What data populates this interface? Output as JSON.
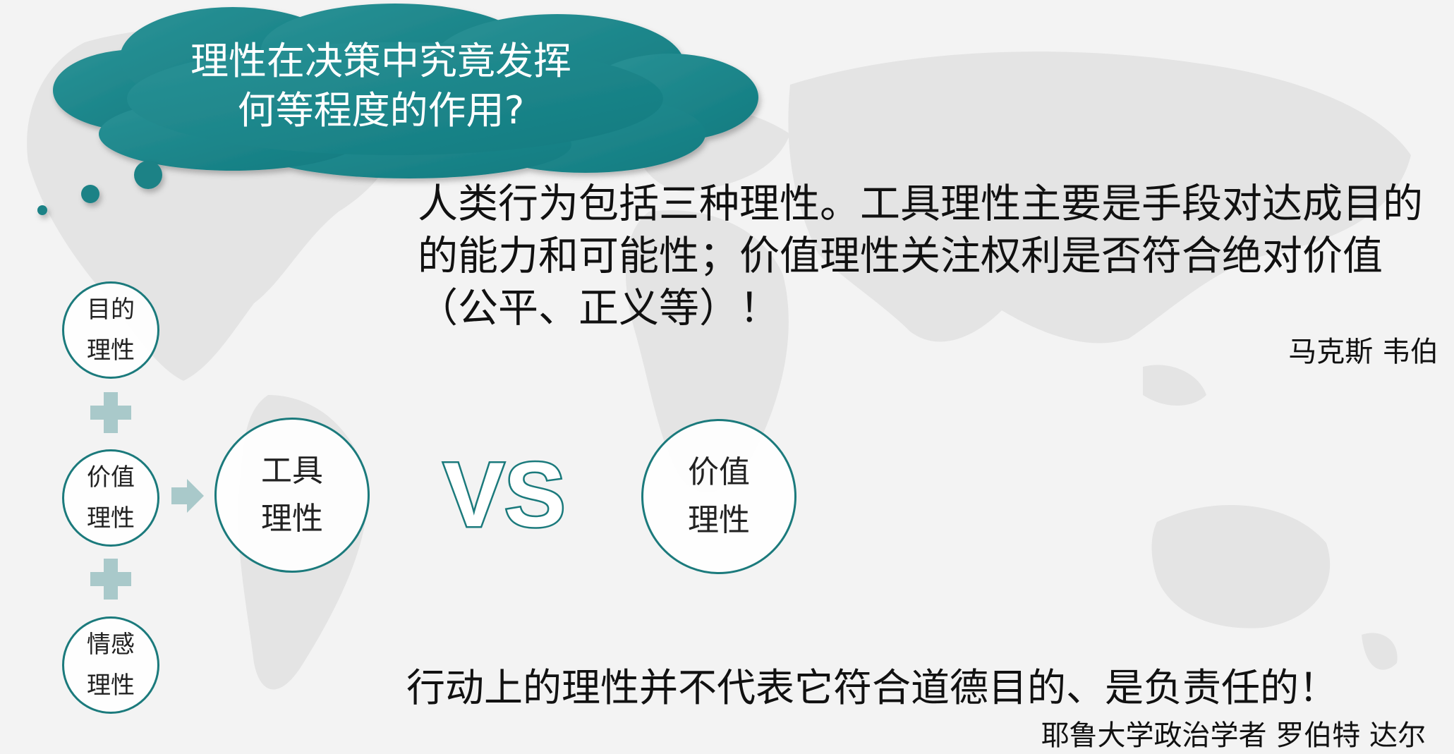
{
  "question": {
    "line1": "理性在决策中究竟发挥",
    "line2": "何等程度的作用?"
  },
  "weber_quote": {
    "text": "人类行为包括三种理性。工具理性主要是手段对达成目的的能力和可能性；价值理性关注权利是否符合绝对价值（公平、正义等）！",
    "author": "马克斯 韦伯"
  },
  "rationalities": [
    {
      "line1": "目的",
      "line2": "理性"
    },
    {
      "line1": "价值",
      "line2": "理性"
    },
    {
      "line1": "情感",
      "line2": "理性"
    }
  ],
  "instrumental": {
    "line1": "工具",
    "line2": "理性"
  },
  "versus": "VS",
  "value_rationality": {
    "line1": "价值",
    "line2": "理性"
  },
  "dahl_quote": {
    "text": "行动上的理性并不代表它符合道德目的、是负责任的！",
    "author": "耶鲁大学政治学者  罗伯特 达尔"
  },
  "colors": {
    "teal": "#1a8286",
    "circle_border": "#1b7a7c",
    "plus": "#a9c9ca",
    "map": "#e6e6e6"
  },
  "icons": [
    "thought-cloud",
    "plus-icon",
    "arrow-right-icon",
    "world-map-background"
  ]
}
